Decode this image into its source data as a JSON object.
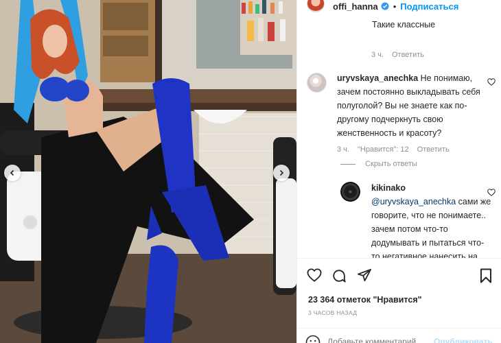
{
  "post": {
    "username": "offi_hanna",
    "follow_label": "Подписаться",
    "separator": "•",
    "likes": "23 364 отметок \"Нравится\"",
    "timestamp": "3 ЧАСОВ НАЗАД"
  },
  "comments": {
    "previous": {
      "text": "Такие классные",
      "time": "3 ч.",
      "reply_label": "Ответить"
    },
    "main": {
      "username": "uryvskaya_anechka",
      "text": "Не понимаю, зачем постоянно выкладывать себя полуголой? Вы не знаете как по-другому подчеркнуть свою женственность и красоту?",
      "time": "3 ч.",
      "likes": "\"Нравится\": 12",
      "reply_label": "Ответить"
    },
    "hide_replies_label": "Скрыть ответы",
    "reply": {
      "username": "kikinako",
      "mention": "@uryvskaya_anechka",
      "text": " сами же говорите, что не понимаете.. зачем потом что-то додумывать и пытаться что-то негативное нанесить на"
    }
  },
  "add_comment": {
    "placeholder": "Добавьте комментарий...",
    "post_label": "Опубликовать"
  },
  "icons": {
    "like": "heart-icon",
    "comment": "comment-icon",
    "share": "share-icon",
    "save": "bookmark-icon",
    "verified": "verified-badge-icon",
    "carousel_prev": "chevron-left-icon",
    "carousel_next": "chevron-right-icon",
    "emoji": "emoji-icon"
  },
  "colors": {
    "accent": "#0095f6",
    "verified": "#3897f0",
    "muted": "#8e8e8e",
    "post_disabled": "#b2dffc"
  }
}
